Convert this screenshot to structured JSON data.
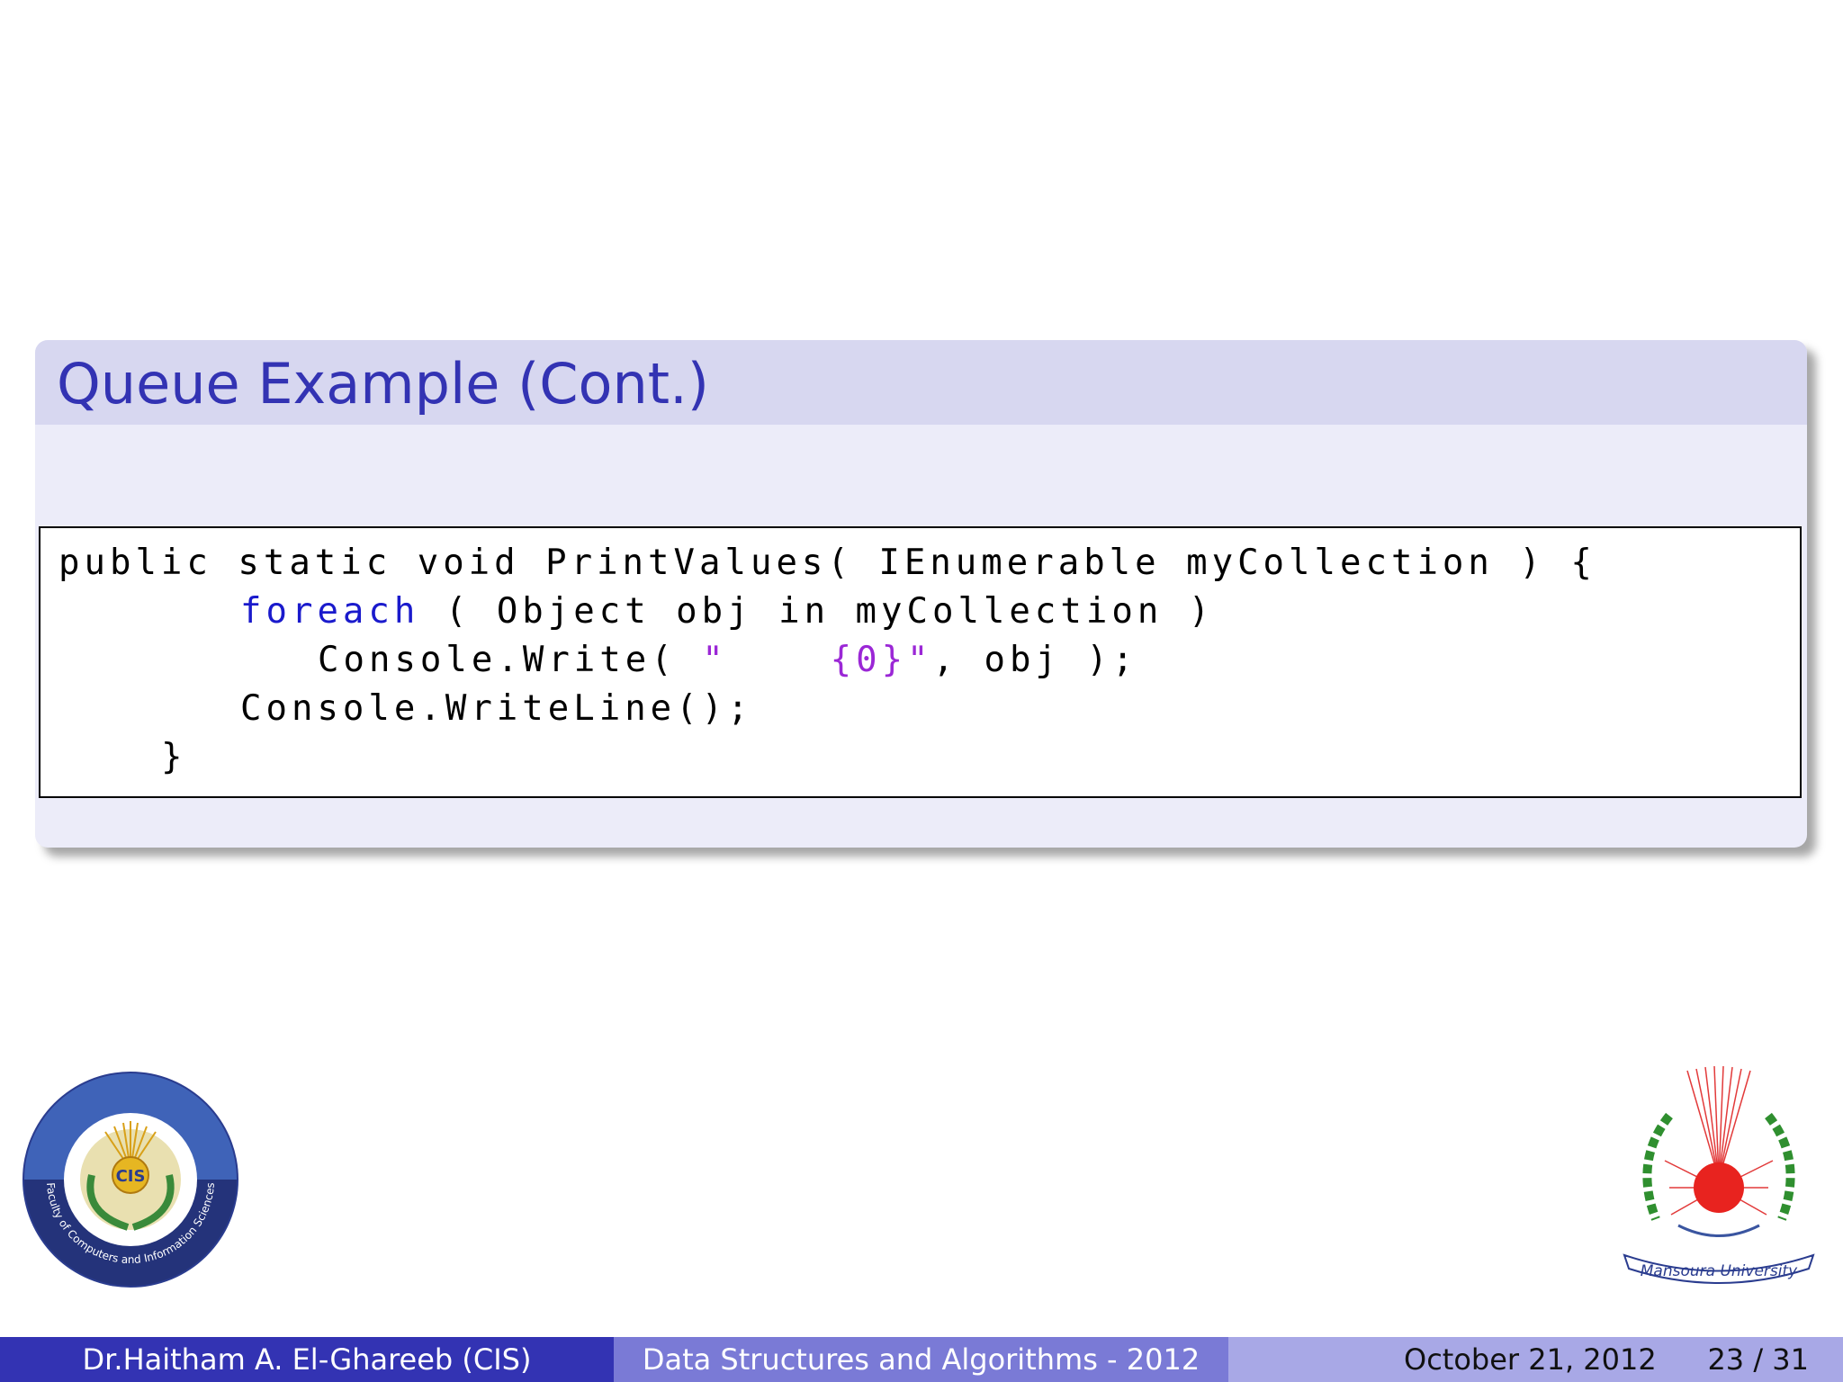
{
  "slide": {
    "title": "Queue Example (Cont.)",
    "code": {
      "l1": "public static void PrintValues( IEnumerable myCollection ) {",
      "l2_kw": "foreach",
      "l2_rest": " ( Object obj in myCollection )",
      "l3_a": "Console.Write( ",
      "l3_str": "\"    {0}\"",
      "l3_b": ", obj );",
      "l4": "Console.WriteLine();",
      "l5": "}"
    }
  },
  "logos": {
    "left_text": "Faculty of Computers and Information Sciences",
    "left_center": "CIS",
    "right_text": "Mansoura University"
  },
  "footer": {
    "author": "Dr.Haitham A. El-Ghareeb  (CIS)",
    "course": "Data Structures and Algorithms - 2012",
    "date": "October 21, 2012",
    "page": "23 / 31"
  },
  "colors": {
    "title": "#3333b3",
    "keyword": "#1a1acc",
    "string": "#9b27d6",
    "footer_dark": "#3333b3",
    "footer_mid": "#7a7ad6",
    "footer_light": "#a8a8e6"
  }
}
